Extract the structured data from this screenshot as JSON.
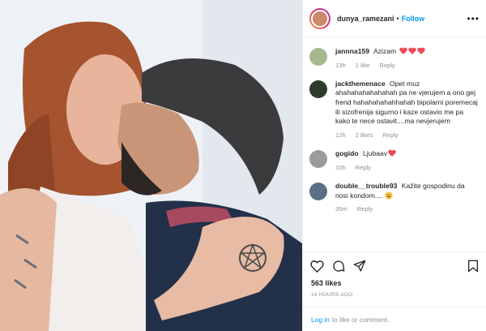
{
  "post": {
    "username": "dunya_ramezani",
    "separator": "•",
    "follow_label": "Follow",
    "more_glyph": "•••",
    "photo_alt": "photo",
    "likes": "563 likes",
    "time_ago": "14 HOURS AGO",
    "login_link": "Log in",
    "login_rest": "to like or comment."
  },
  "comments": [
    {
      "user": "jannna159",
      "text": "Azizam",
      "emoji": "heart-icon-x3",
      "time": "13h",
      "likes": "1 like",
      "reply": "Reply"
    },
    {
      "user": "jackthemenace",
      "text": "Opet muz ahahahahahahahah pa ne vjerujem a ono gej frend hahahahahahhahah bipolarni poremecaj ili sizofrenija sigurno i kaze ostavio me pa kako te nece ostavit....ma nevjerujem",
      "time": "12h",
      "likes": "2 likes",
      "reply": "Reply"
    },
    {
      "user": "gogido",
      "text": "Ljubaav",
      "emoji": "heart-icon",
      "time": "10h",
      "reply": "Reply"
    },
    {
      "user": "double__trouble93",
      "text": "Kažite gospodinu da nosi kondom....",
      "emoji": "laughing-face-icon",
      "time": "35m",
      "reply": "Reply"
    }
  ],
  "colors": {
    "accent": "#0095f6",
    "muted": "#8e8e8e",
    "heart": "#ed4956"
  }
}
